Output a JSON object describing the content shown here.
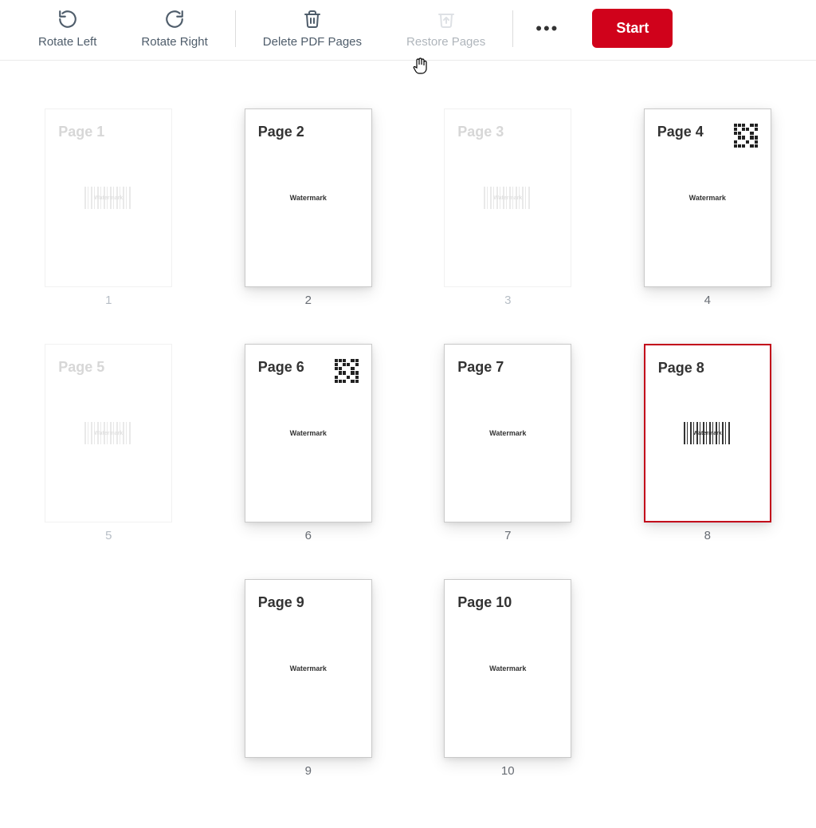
{
  "toolbar": {
    "rotate_left": "Rotate Left",
    "rotate_right": "Rotate Right",
    "delete_pages": "Delete PDF Pages",
    "restore_pages": "Restore Pages",
    "start": "Start"
  },
  "pages": [
    {
      "index": "1",
      "title": "Page 1",
      "content": "barcode",
      "dimmed": true,
      "shadowed": false,
      "selected": false,
      "qr": false
    },
    {
      "index": "2",
      "title": "Page 2",
      "content": "watermark",
      "dimmed": false,
      "shadowed": true,
      "selected": false,
      "qr": false,
      "watermark": "Watermark"
    },
    {
      "index": "3",
      "title": "Page 3",
      "content": "barcode",
      "dimmed": true,
      "shadowed": false,
      "selected": false,
      "qr": false
    },
    {
      "index": "4",
      "title": "Page 4",
      "content": "watermark",
      "dimmed": false,
      "shadowed": true,
      "selected": false,
      "qr": true,
      "watermark": "Watermark"
    },
    {
      "index": "5",
      "title": "Page 5",
      "content": "barcode",
      "dimmed": true,
      "shadowed": false,
      "selected": false,
      "qr": false
    },
    {
      "index": "6",
      "title": "Page 6",
      "content": "watermark",
      "dimmed": false,
      "shadowed": true,
      "selected": false,
      "qr": true,
      "watermark": "Watermark"
    },
    {
      "index": "7",
      "title": "Page 7",
      "content": "watermark",
      "dimmed": false,
      "shadowed": true,
      "selected": false,
      "qr": false,
      "watermark": "Watermark"
    },
    {
      "index": "8",
      "title": "Page 8",
      "content": "barcode",
      "dimmed": false,
      "shadowed": true,
      "selected": true,
      "qr": false
    },
    {
      "index": "9",
      "title": "Page 9",
      "content": "watermark",
      "dimmed": false,
      "shadowed": true,
      "selected": false,
      "qr": false,
      "watermark": "Watermark"
    },
    {
      "index": "10",
      "title": "Page 10",
      "content": "watermark",
      "dimmed": false,
      "shadowed": true,
      "selected": false,
      "qr": false,
      "watermark": "Watermark"
    }
  ],
  "barcode_label": "Watermark"
}
